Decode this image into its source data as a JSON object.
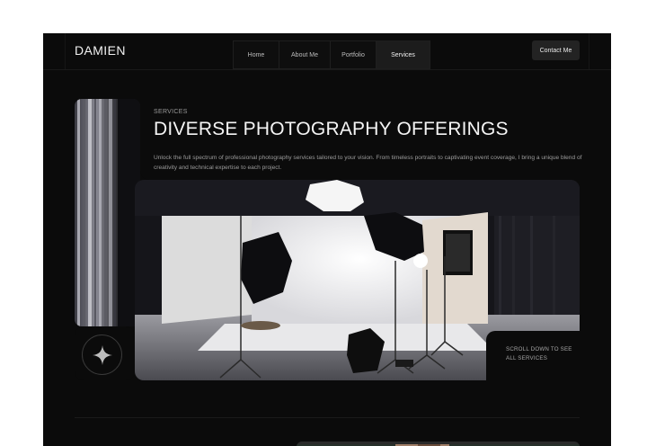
{
  "header": {
    "brand": "DAMIEN",
    "nav": [
      {
        "label": "Home"
      },
      {
        "label": "About Me"
      },
      {
        "label": "Portfolio"
      },
      {
        "label": "Services"
      }
    ],
    "active_nav": "Services",
    "contact_label": "Contact Me"
  },
  "hero": {
    "section_label": "SERVICES",
    "headline": "DIVERSE PHOTOGRAPHY OFFERINGS",
    "intro": "Unlock the full spectrum of professional photography services tailored to your vision. From timeless portraits to captivating event coverage, I bring a unique blend of creativity and technical expertise to each project.",
    "scroll_line1": "SCROLL DOWN TO SEE",
    "scroll_line2": "ALL SERVICES",
    "star_icon": "four-point-star-icon"
  },
  "colors": {
    "background": "#0b0b0b",
    "page_bg": "#ffffff",
    "text_primary": "#f4f4f4",
    "text_muted": "#9c9c9c",
    "button_bg": "#232323"
  }
}
